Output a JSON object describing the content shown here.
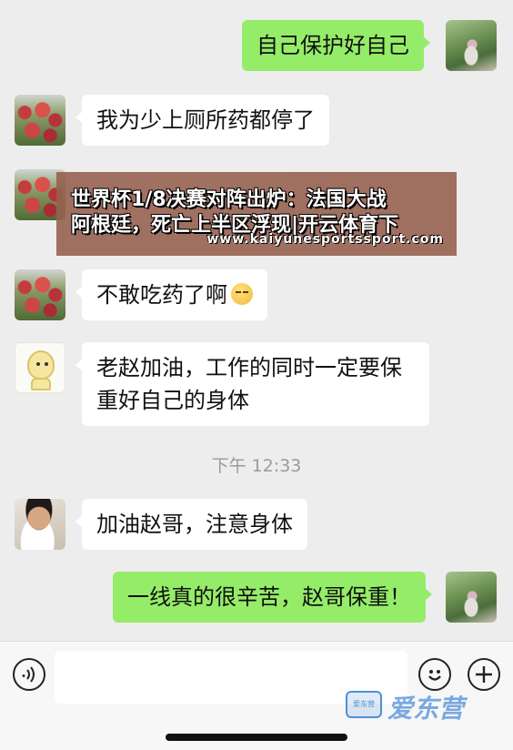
{
  "messages": [
    {
      "side": "right",
      "avatar": "park-photo-avatar",
      "text": "自己保护好自己"
    },
    {
      "side": "left",
      "avatar": "flowers-avatar",
      "text": "我为少上厕所药都停了"
    },
    {
      "side": "left",
      "avatar": "flowers-avatar",
      "text": ""
    },
    {
      "side": "left",
      "avatar": "flowers-avatar",
      "text": "不敢吃药了啊",
      "emoji": "sleepy-face-emoji"
    },
    {
      "side": "left",
      "avatar": "cartoon-avatar",
      "line1": "老赵加油，工作的同时一定要保",
      "line2": "重好自己的身体"
    },
    {
      "side": "left",
      "avatar": "man-avatar",
      "text": "加油赵哥，注意身体"
    },
    {
      "side": "right",
      "avatar": "park-photo-avatar",
      "text": "一线真的很辛苦，赵哥保重！"
    }
  ],
  "timestamp": "下午 12:33",
  "overlay": {
    "line1": "世界杯1/8决赛对阵出炉：法国大战",
    "line2": "阿根廷，死亡上半区浮现|开云体育下",
    "url": "www.kaiyunesportssport.com"
  },
  "watermark": {
    "logo_text": "爱东营",
    "text": "爱东营"
  },
  "colors": {
    "sent_bubble": "#95ec69",
    "received_bubble": "#ffffff",
    "background": "#ededed",
    "overlay": "#966050"
  },
  "icons": {
    "voice": "voice-icon",
    "emoji": "emoji-icon",
    "plus": "plus-icon"
  }
}
